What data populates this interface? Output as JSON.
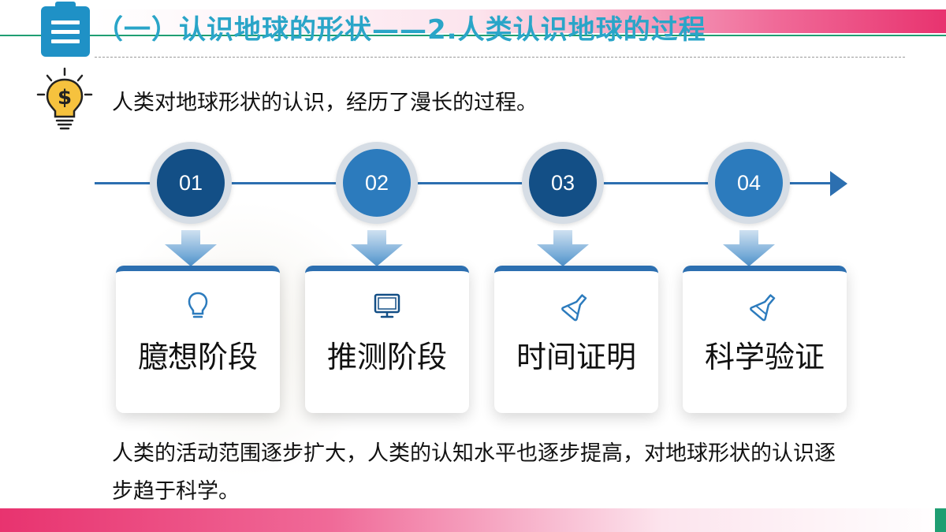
{
  "header": {
    "title": "（一）认识地球的形状——2.人类认识地球的过程",
    "icon": "menu-list-icon",
    "accent_color": "#2aa5c8"
  },
  "intro": {
    "icon": "lightbulb-dollar-icon",
    "text": "人类对地球形状的认识，经历了漫长的过程。"
  },
  "timeline": {
    "steps": [
      {
        "number": "01",
        "label": "臆想阶段",
        "icon": "lightbulb-icon"
      },
      {
        "number": "02",
        "label": "推测阶段",
        "icon": "monitor-icon"
      },
      {
        "number": "03",
        "label": "时间证明",
        "icon": "flask-icon"
      },
      {
        "number": "04",
        "label": "科学验证",
        "icon": "flask-icon"
      }
    ],
    "colors": {
      "dark": "#134f86",
      "light": "#2c7bbd",
      "line": "#2c6fb0"
    }
  },
  "conclusion": {
    "text": "人类的活动范围逐步扩大，人类的认知水平也逐步提高，对地球形状的认识逐步趋于科学。"
  },
  "theme": {
    "pink": "#e8336f",
    "green": "#1f9e72"
  }
}
